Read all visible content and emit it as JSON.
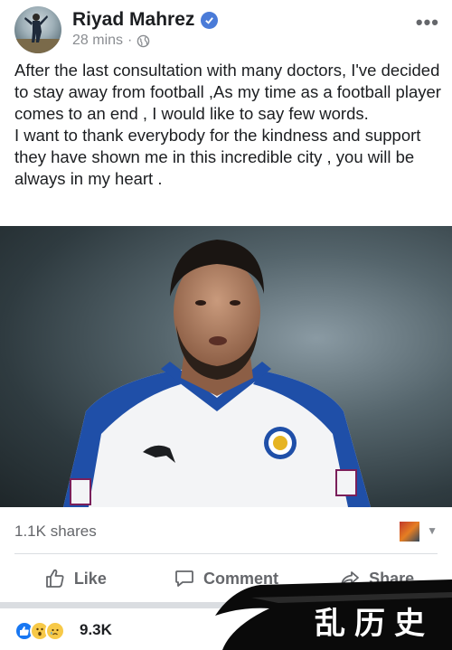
{
  "post": {
    "author": "Riyad Mahrez",
    "time": "28 mins",
    "dot": "·",
    "paragraphs": [
      "After the last consultation with many doctors, I've decided to stay away from football ,As my time as a football player comes to an end , I would like to say few words.",
      "I want to thank everybody for the kindness and support they have shown me in this incredible city , you will be always in my heart ."
    ],
    "shares": "1.1K shares",
    "reactions_count": "9.3K"
  },
  "actions": {
    "like": "Like",
    "comment": "Comment",
    "share": "Share"
  },
  "watermark": {
    "text": "乱历史"
  },
  "colors": {
    "verified": "#4a7bd8",
    "like": "#1877f2",
    "shirt_blue": "#1f4fa8"
  },
  "icons": [
    "verified-icon",
    "globe-icon",
    "more-icon",
    "like-icon",
    "comment-icon",
    "share-icon",
    "like-reaction-icon",
    "wow-reaction-icon",
    "sad-reaction-icon"
  ]
}
